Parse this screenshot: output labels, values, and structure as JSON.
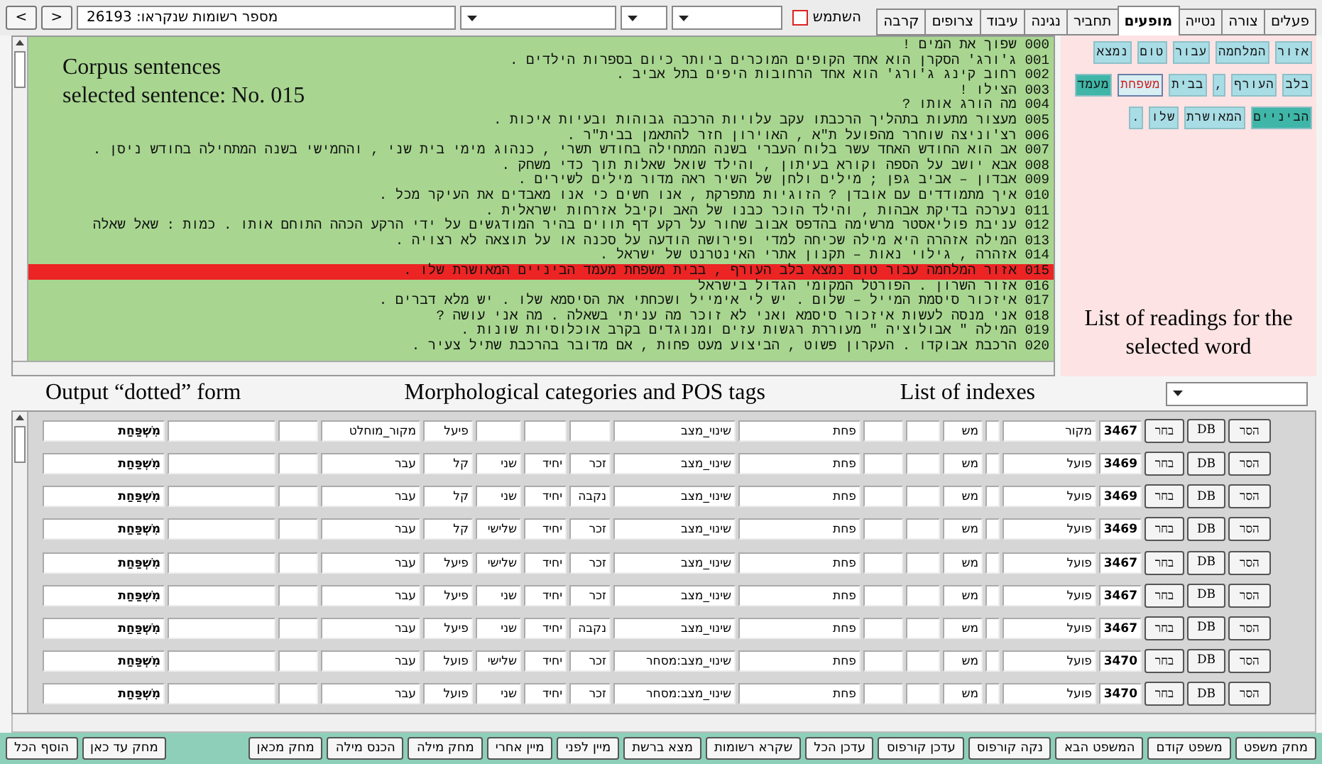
{
  "toolbar": {
    "nav_buttons": [
      ">",
      "<"
    ],
    "records_field": {
      "value": "מספר רשומות שנקראו: 26193"
    },
    "use_checkbox": {
      "label": "השתמש",
      "checked": false
    }
  },
  "tabs": [
    {
      "label": "פעלים",
      "selected": false
    },
    {
      "label": "צורה",
      "selected": false
    },
    {
      "label": "נטייה",
      "selected": false
    },
    {
      "label": "מופעים",
      "selected": true
    },
    {
      "label": "תחביר",
      "selected": false
    },
    {
      "label": "נגינה",
      "selected": false
    },
    {
      "label": "עיבוד",
      "selected": false
    },
    {
      "label": "צרופים",
      "selected": false
    },
    {
      "label": "קרבה",
      "selected": false
    }
  ],
  "sentences": {
    "annotation_lines": [
      "Corpus sentences",
      "selected sentence: No. 015"
    ],
    "items": [
      {
        "number": "000",
        "text": "שפוך את המים !",
        "selected": false
      },
      {
        "number": "001",
        "text": "ג'ורג' הסקרן הוא אחד הקופים המוכרים ביותר כיום בספרות הילדים .",
        "selected": false
      },
      {
        "number": "002",
        "text": "רחוב קינג ג'ורג' הוא אחד הרחובות היפים בתל אביב .",
        "selected": false
      },
      {
        "number": "003",
        "text": "הצילו !",
        "selected": false
      },
      {
        "number": "004",
        "text": "מה הורג אותו ?",
        "selected": false
      },
      {
        "number": "005",
        "text": "מעצור מתעות בתהליך הרכבתו עקב עלויות הרכבה גבוהות ובעיות איכות .",
        "selected": false
      },
      {
        "number": "006",
        "text": "רצ'וניצה שוחרר מהפועל ת\"א , האוירון חזר להתאמן בבית\"ר .",
        "selected": false
      },
      {
        "number": "007",
        "text": "אב הוא החודש האחד עשר בלוח העברי בשנה המתחילה בחודש תשרי , כנהוג מימי בית שני , והחמישי בשנה המתחילה בחודש ניסן .",
        "selected": false
      },
      {
        "number": "008",
        "text": "אבא יושב על הספה וקורא בעיתון , והילד שואל שאלות תוך כדי משחק .",
        "selected": false
      },
      {
        "number": "009",
        "text": "אבדון – אביב גפן ; מילים ולחן של השיר ראה מדור מילים לשירים .",
        "selected": false
      },
      {
        "number": "010",
        "text": "איך מתמודדים עם אובדן ? הזוגיות מתפרקת , אנו חשים כי אנו מאבדים את העיקר מכל .",
        "selected": false
      },
      {
        "number": "011",
        "text": "נערכה בדיקת אבהות , והילד הוכר כבנו של האב וקיבל אזרחות ישראלית .",
        "selected": false
      },
      {
        "number": "012",
        "text": "עניבת פוליאסטר מרשימה בהדפס אבוב שחור על רקע דף תווים בהיר המודגשים על ידי הרקע הכהה התוחם אותו . כמות : שאל שאלה",
        "selected": false
      },
      {
        "number": "013",
        "text": "המילה אזהרה היא מילה שכיחה למדי ופירושה הודעה על סכנה או על תוצאה לא רצויה .",
        "selected": false
      },
      {
        "number": "014",
        "text": "אזהרה , גילוי נאות – תקנון אתרי האינטרנט של ישראל .",
        "selected": false
      },
      {
        "number": "015",
        "text": "אזור המלחמה עבור טום נמצא בלב העורף , בבית משפחת מעמד הביניים המאושרת שלו .",
        "selected": true
      },
      {
        "number": "016",
        "text": "אזור השרון . הפורטל המקומי הגדול בישראל",
        "selected": false
      },
      {
        "number": "017",
        "text": "איזכור סיסמת המייל – שלום . יש לי אימייל ושכחתי את הסיסמא שלו . יש מלא דברים .",
        "selected": false
      },
      {
        "number": "018",
        "text": "אני מנסה לעשות איזכור סיסמא ואני לא זוכר מה עניתי בשאלה . מה אני עושה ?",
        "selected": false
      },
      {
        "number": "019",
        "text": "המילה \" אבולוציה \" מעוררת רגשות עזים ומנוגדים בקרב אוכלוסיות שונות .",
        "selected": false
      },
      {
        "number": "020",
        "text": "הרכבת אבוקדו . העקרון פשוט , הביצוע מעט פחות , אם מדובר בהרכבת שתיל צעיר .",
        "selected": false
      }
    ]
  },
  "readings": {
    "annotation": "List of readings for the selected word",
    "words": [
      {
        "text": "אזור",
        "selected": false,
        "highlighted": false
      },
      {
        "text": "המלחמה",
        "selected": false,
        "highlighted": false
      },
      {
        "text": "עבור",
        "selected": false,
        "highlighted": false
      },
      {
        "text": "טום",
        "selected": false,
        "highlighted": false
      },
      {
        "text": "נמצא",
        "selected": false,
        "highlighted": false
      },
      {
        "text": "בלב",
        "selected": false,
        "highlighted": false
      },
      {
        "text": "העורף",
        "selected": false,
        "highlighted": false
      },
      {
        "text": ",",
        "selected": false,
        "highlighted": false
      },
      {
        "text": "בבית",
        "selected": false,
        "highlighted": false
      },
      {
        "text": "משפחת",
        "selected": true,
        "highlighted": false
      },
      {
        "text": "מעמד",
        "selected": false,
        "highlighted": true
      },
      {
        "text": "הביניים",
        "selected": false,
        "highlighted": true
      },
      {
        "text": "המאושרת",
        "selected": false,
        "highlighted": false
      },
      {
        "text": "שלו",
        "selected": false,
        "highlighted": false
      },
      {
        "text": ".",
        "selected": false,
        "highlighted": false
      }
    ]
  },
  "annotations": {
    "output_form": "Output “dotted” form",
    "categories": "Morphological categories and POS tags",
    "indexes": "List of indexes"
  },
  "table": {
    "rows": [
      {
        "buttons": [
          "הסר",
          "DB",
          "בחר"
        ],
        "index": "3467",
        "category": "מקור",
        "column_4": "מש",
        "root": "פחת",
        "meaning": "שינוי_מצב",
        "binyan": "פיעל",
        "tense": "מקור_מוחלט",
        "dotted_form": "מִשְׁפַּחַת"
      },
      {
        "buttons": [
          "הסר",
          "DB",
          "בחר"
        ],
        "index": "3469",
        "category": "פועל",
        "column_4": "מש",
        "root": "פחת",
        "meaning": "שינוי_מצב",
        "gender": "זכר",
        "number": "יחיד",
        "person": "שני",
        "binyan": "קל",
        "tense": "עבר",
        "dotted_form": "מִשְׁפַּחַת"
      },
      {
        "buttons": [
          "הסר",
          "DB",
          "בחר"
        ],
        "index": "3469",
        "category": "פועל",
        "column_4": "מש",
        "root": "פחת",
        "meaning": "שינוי_מצב",
        "gender": "נקבה",
        "number": "יחיד",
        "person": "שני",
        "binyan": "קל",
        "tense": "עבר",
        "dotted_form": "מִשְׁפַּחַת"
      },
      {
        "buttons": [
          "הסר",
          "DB",
          "בחר"
        ],
        "index": "3469",
        "category": "פועל",
        "column_4": "מש",
        "root": "פחת",
        "meaning": "שינוי_מצב",
        "gender": "זכר",
        "number": "יחיד",
        "person": "שלישי",
        "binyan": "קל",
        "tense": "עבר",
        "dotted_form": "מִשְׁפַּחַת"
      },
      {
        "buttons": [
          "הסר",
          "DB",
          "בחר"
        ],
        "index": "3467",
        "category": "פועל",
        "column_4": "מש",
        "root": "פחת",
        "meaning": "שינוי_מצב",
        "gender": "זכר",
        "number": "יחיד",
        "person": "שלישי",
        "binyan": "פיעל",
        "tense": "עבר",
        "dotted_form": "מִשְׁפַּחַת"
      },
      {
        "buttons": [
          "הסר",
          "DB",
          "בחר"
        ],
        "index": "3467",
        "category": "פועל",
        "column_4": "מש",
        "root": "פחת",
        "meaning": "שינוי_מצב",
        "gender": "זכר",
        "number": "יחיד",
        "person": "שני",
        "binyan": "פיעל",
        "tense": "עבר",
        "dotted_form": "מִשְׁפַּחַת"
      },
      {
        "buttons": [
          "הסר",
          "DB",
          "בחר"
        ],
        "index": "3467",
        "category": "פועל",
        "column_4": "מש",
        "root": "פחת",
        "meaning": "שינוי_מצב",
        "gender": "נקבה",
        "number": "יחיד",
        "person": "שני",
        "binyan": "פיעל",
        "tense": "עבר",
        "dotted_form": "מִשְׁפַּחַת"
      },
      {
        "buttons": [
          "הסר",
          "DB",
          "בחר"
        ],
        "index": "3470",
        "category": "פועל",
        "column_4": "מש",
        "root": "פחת",
        "meaning": "שינוי_מצב:מסחר",
        "gender": "זכר",
        "number": "יחיד",
        "person": "שלישי",
        "binyan": "פועל",
        "tense": "עבר",
        "dotted_form": "מִשְׁפַּחַת"
      },
      {
        "buttons": [
          "הסר",
          "DB",
          "בחר"
        ],
        "index": "3470",
        "category": "פועל",
        "column_4": "מש",
        "root": "פחת",
        "meaning": "שינוי_מצב:מסחר",
        "gender": "זכר",
        "number": "יחיד",
        "person": "שני",
        "binyan": "פועל",
        "tense": "עבר",
        "dotted_form": "מִשְׁפַּחַת"
      }
    ]
  },
  "buttons": [
    "מחק משפט",
    "משפט קודם",
    "המשפט הבא",
    "נקה קורפוס",
    "עדכן קורפוס",
    "עדכן הכל",
    "שקרא רשומות",
    "מצא ברשת",
    "מיין לפני",
    "מיין אחרי",
    "מחק מילה",
    "הכנס מילה",
    "מחק מכאן",
    "מחק עד כאן",
    "הוסף הכל"
  ]
}
